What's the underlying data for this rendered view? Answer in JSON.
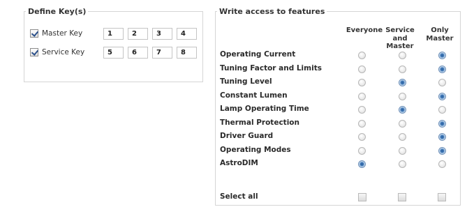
{
  "define_keys": {
    "title": "Define Key(s)",
    "rows": [
      {
        "label": "Master Key",
        "checked": true,
        "values": [
          "1",
          "2",
          "3",
          "4"
        ]
      },
      {
        "label": "Service Key",
        "checked": true,
        "values": [
          "5",
          "6",
          "7",
          "8"
        ]
      }
    ]
  },
  "write_access": {
    "title": "Write access to features",
    "columns": [
      "Everyone",
      "Service and Master",
      "Only Master"
    ],
    "features": [
      {
        "label": "Operating Current",
        "selected": 2
      },
      {
        "label": "Tuning Factor and Limits",
        "selected": 2
      },
      {
        "label": "Tuning Level",
        "selected": 1
      },
      {
        "label": "Constant Lumen",
        "selected": 2
      },
      {
        "label": "Lamp Operating Time",
        "selected": 1
      },
      {
        "label": "Thermal Protection",
        "selected": 2
      },
      {
        "label": "Driver Guard",
        "selected": 2
      },
      {
        "label": "Operating Modes",
        "selected": 2
      },
      {
        "label": "AstroDIM",
        "selected": 0
      }
    ],
    "select_all_label": "Select all"
  },
  "colors": {
    "radio_selected": "#2a5d9a",
    "border": "#d5d5d5"
  }
}
